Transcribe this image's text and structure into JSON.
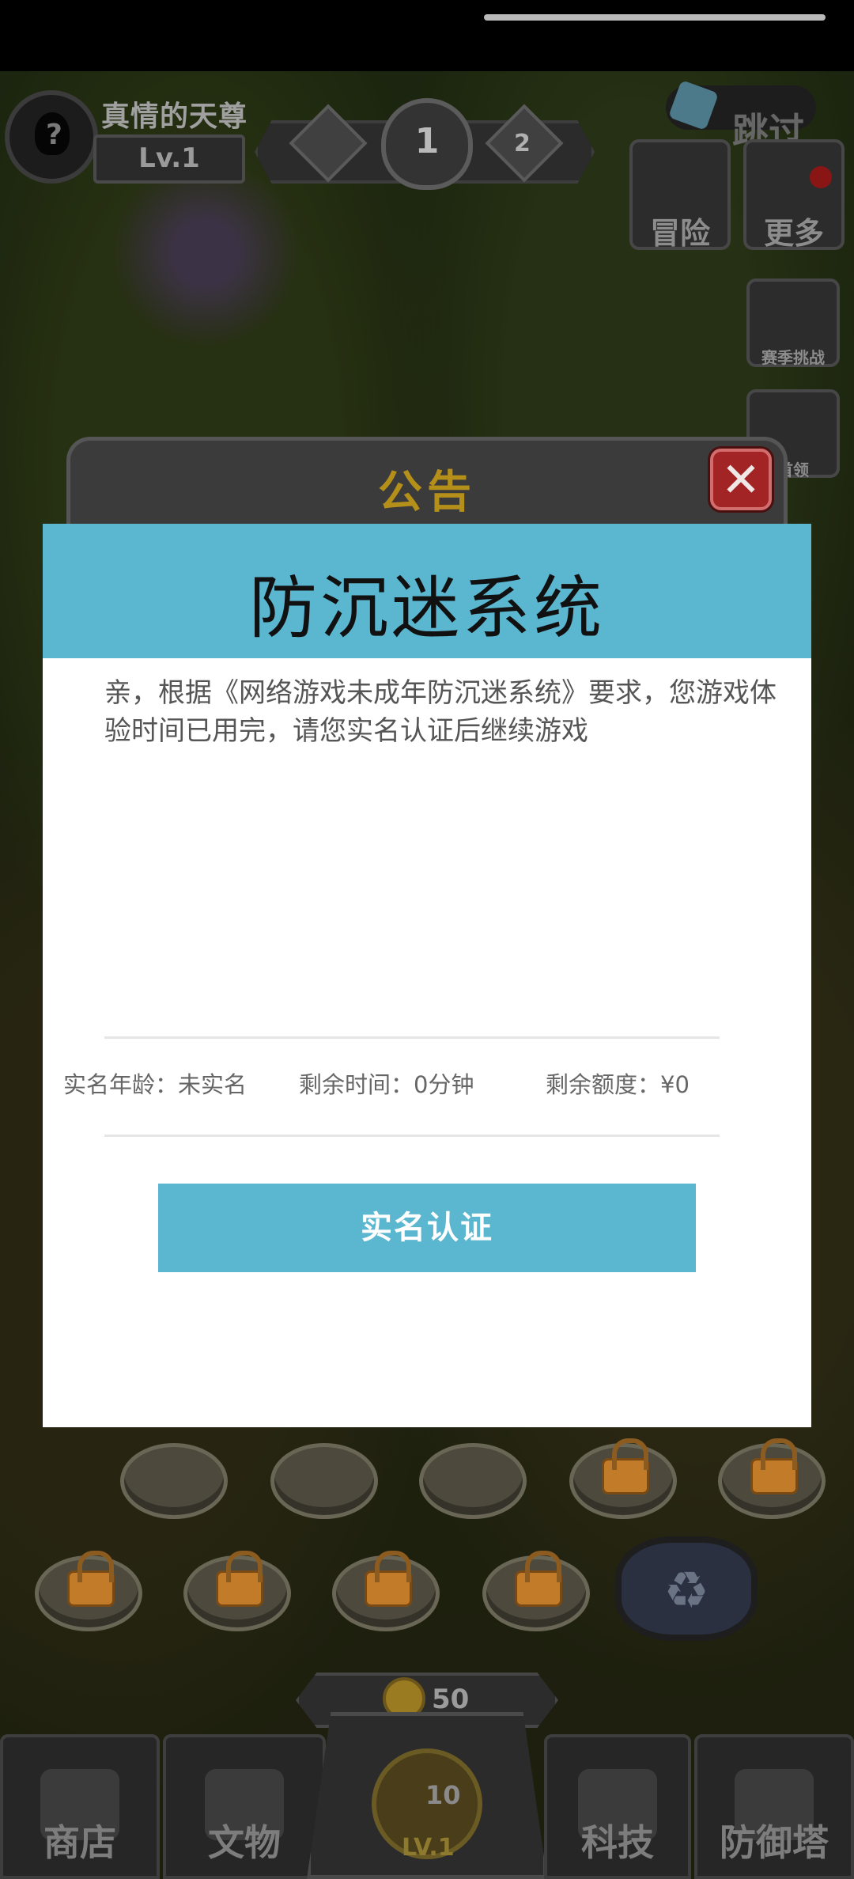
{
  "hud": {
    "player_name": "真情的天尊",
    "level": "Lv.1",
    "stage_current": "1",
    "stage_next": "2",
    "skip_label": "跳过",
    "adventure_label": "冒险",
    "more_label": "更多",
    "season_label": "赛季挑战",
    "boss_label": "首领"
  },
  "notice": {
    "header_title": "公告"
  },
  "dialog": {
    "title": "防沉迷系统",
    "message": "亲，根据《网络游戏未成年防沉迷系统》要求，您游戏体验时间已用完，请您实名认证后继续游戏",
    "age_text": "实名年龄：未实名",
    "time_text": "剩余时间：0分钟",
    "quota_text": "剩余额度：¥0",
    "verify_button": "实名认证"
  },
  "bottom": {
    "coins": "50",
    "center_count": "10",
    "center_level": "LV.1",
    "nav": [
      {
        "label": "商店"
      },
      {
        "label": "文物"
      },
      {
        "label": "科技"
      },
      {
        "label": "防御塔"
      }
    ]
  },
  "icons": [
    "avatar-icon",
    "gem-icon",
    "scroll-icon",
    "menu-icon",
    "close-icon",
    "lock-icon",
    "recycle-icon",
    "coin-icon"
  ],
  "colors": {
    "dialog_header": "#5bb6d0",
    "verify_button": "#5bb6d0",
    "close_button": "#a32424",
    "notice_title": "#b48f1a"
  }
}
